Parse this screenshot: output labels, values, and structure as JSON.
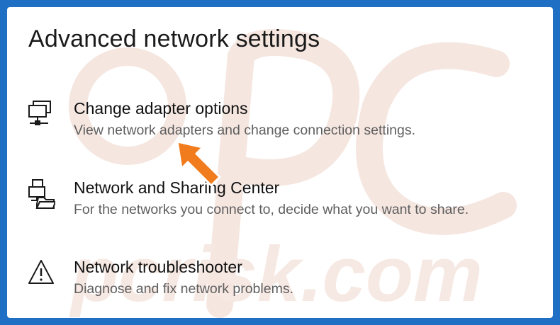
{
  "page": {
    "title": "Advanced network settings"
  },
  "items": [
    {
      "label": "Change adapter options",
      "description": "View network adapters and change connection settings.",
      "icon": "network-adapter-icon"
    },
    {
      "label": "Network and Sharing Center",
      "description": "For the networks you connect to, decide what you want to share.",
      "icon": "network-sharing-icon"
    },
    {
      "label": "Network troubleshooter",
      "description": "Diagnose and fix network problems.",
      "icon": "warning-triangle-icon"
    }
  ],
  "watermark": {
    "text": "pcrisk.com"
  },
  "colors": {
    "border": "#1f6fc4",
    "arrow": "#f07c1e",
    "watermark": "#f3e2dc"
  }
}
